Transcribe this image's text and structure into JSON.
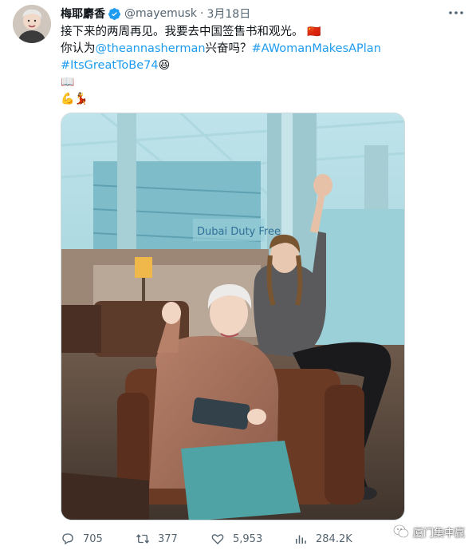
{
  "author": {
    "name": "梅耶麝香",
    "handle": "@mayemusk",
    "date": "3月18日",
    "separator": "·"
  },
  "tweet": {
    "line1": "接下来的两周再见。我要去中国签售书和观光。",
    "line1_flag": "🇨🇳",
    "line2_prefix": "你认为",
    "line2_mention": "@theannasherman",
    "line2_mid": "兴奋吗？",
    "line2_hashtag": "#AWomanMakesAPlan",
    "line3_hashtag": "#ItsGreatToBe74",
    "line3_emoji": "😆",
    "line4_emoji": "📖",
    "line5_emoji": "💪💃"
  },
  "media": {
    "sign_text": "Dubai Duty Free"
  },
  "actions": {
    "replies": "705",
    "retweets": "377",
    "likes": "5,953",
    "views": "284.2K"
  },
  "watermark": {
    "text": "厦门集中赢"
  },
  "colors": {
    "link": "#1d9bf0",
    "muted": "#536471",
    "verified": "#1d9bf0"
  }
}
